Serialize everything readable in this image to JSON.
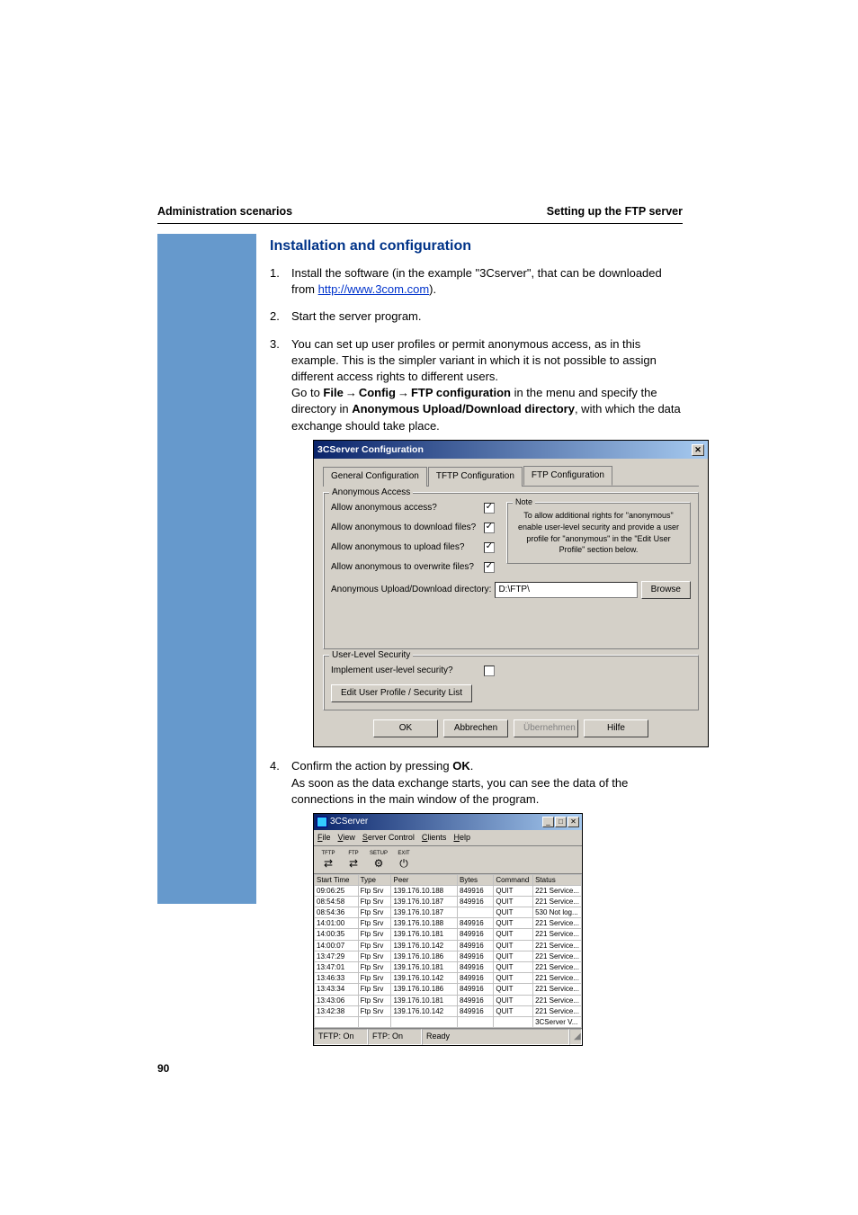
{
  "header": {
    "left": "Administration scenarios",
    "right": "Setting up the FTP server"
  },
  "section_title": "Installation and configuration",
  "steps": {
    "s1a": "Install the software (in the example \"3Cserver\", that can be downloaded from ",
    "s1_link": "http://www.3com.com",
    "s1b": ").",
    "s2": "Start the server program.",
    "s3a": "You can set up user profiles or permit anonymous access, as in this example. This is the simpler variant in which it is not possible to assign different access rights to different users.",
    "s3b_pre": "Go to ",
    "s3b_file": "File",
    "s3b_config": "Config",
    "s3b_ftp": "FTP configuration",
    "s3b_mid": " in the menu and specify the directory in ",
    "s3b_anon": "Anonymous Upload/Download directory",
    "s3b_end": ", with which the data exchange should take place.",
    "s4a": "Confirm the action by pressing ",
    "s4_ok": "OK",
    "s4b": ".",
    "s4c": "As soon as the data exchange starts, you can see the data of the connections in the main window of the program."
  },
  "dialog": {
    "title": "3CServer Configuration",
    "tab1": "General Configuration",
    "tab2": "TFTP Configuration",
    "tab3": "FTP Configuration",
    "group_anonymous": "Anonymous Access",
    "group_userlevel": "User-Level Security",
    "note_legend": "Note",
    "note_text": "To allow additional rights for \"anonymous\" enable user-level security and provide a user profile for \"anonymous\" in the \"Edit User Profile\" section below.",
    "lbl_allow_anon": "Allow anonymous access?",
    "lbl_allow_dl": "Allow anonymous to download files?",
    "lbl_allow_ul": "Allow anonymous to upload files?",
    "lbl_allow_ow": "Allow anonymous to overwrite files?",
    "lbl_upload_dir": "Anonymous Upload/Download directory:",
    "dir_value": "D:\\FTP\\",
    "browse": "Browse",
    "lbl_impl_user": "Implement user-level security?",
    "btn_edit_profile": "Edit User Profile / Security List",
    "btn_ok": "OK",
    "btn_cancel": "Abbrechen",
    "btn_apply": "Übernehmen",
    "btn_help": "Hilfe"
  },
  "window": {
    "title": "3CServer",
    "menu": [
      "File",
      "View",
      "Server Control",
      "Clients",
      "Help"
    ],
    "toolbar": [
      {
        "label": "TFTP"
      },
      {
        "label": "FTP"
      },
      {
        "label": "SETUP"
      },
      {
        "label": "EXIT"
      }
    ],
    "cols": [
      "Start Time",
      "Type",
      "Peer",
      "Bytes",
      "Command",
      "Status"
    ],
    "rows": [
      [
        "09:06:25",
        "Ftp Srv",
        "139.176.10.188",
        "849916",
        "QUIT",
        "221 Service..."
      ],
      [
        "08:54:58",
        "Ftp Srv",
        "139.176.10.187",
        "849916",
        "QUIT",
        "221 Service..."
      ],
      [
        "08:54:36",
        "Ftp Srv",
        "139.176.10.187",
        "",
        "QUIT",
        "530 Not log..."
      ],
      [
        "14:01:00",
        "Ftp Srv",
        "139.176.10.188",
        "849916",
        "QUIT",
        "221 Service..."
      ],
      [
        "14:00:35",
        "Ftp Srv",
        "139.176.10.181",
        "849916",
        "QUIT",
        "221 Service..."
      ],
      [
        "14:00:07",
        "Ftp Srv",
        "139.176.10.142",
        "849916",
        "QUIT",
        "221 Service..."
      ],
      [
        "13:47:29",
        "Ftp Srv",
        "139.176.10.186",
        "849916",
        "QUIT",
        "221 Service..."
      ],
      [
        "13:47:01",
        "Ftp Srv",
        "139.176.10.181",
        "849916",
        "QUIT",
        "221 Service..."
      ],
      [
        "13:46:33",
        "Ftp Srv",
        "139.176.10.142",
        "849916",
        "QUIT",
        "221 Service..."
      ],
      [
        "13:43:34",
        "Ftp Srv",
        "139.176.10.186",
        "849916",
        "QUIT",
        "221 Service..."
      ],
      [
        "13:43:06",
        "Ftp Srv",
        "139.176.10.181",
        "849916",
        "QUIT",
        "221 Service..."
      ],
      [
        "13:42:38",
        "Ftp Srv",
        "139.176.10.142",
        "849916",
        "QUIT",
        "221 Service..."
      ],
      [
        "",
        "",
        "",
        "",
        "",
        "3CServer V..."
      ]
    ],
    "status": {
      "tftp": "TFTP: On",
      "ftp": "FTP: On",
      "ready": "Ready"
    }
  },
  "page_number": "90"
}
